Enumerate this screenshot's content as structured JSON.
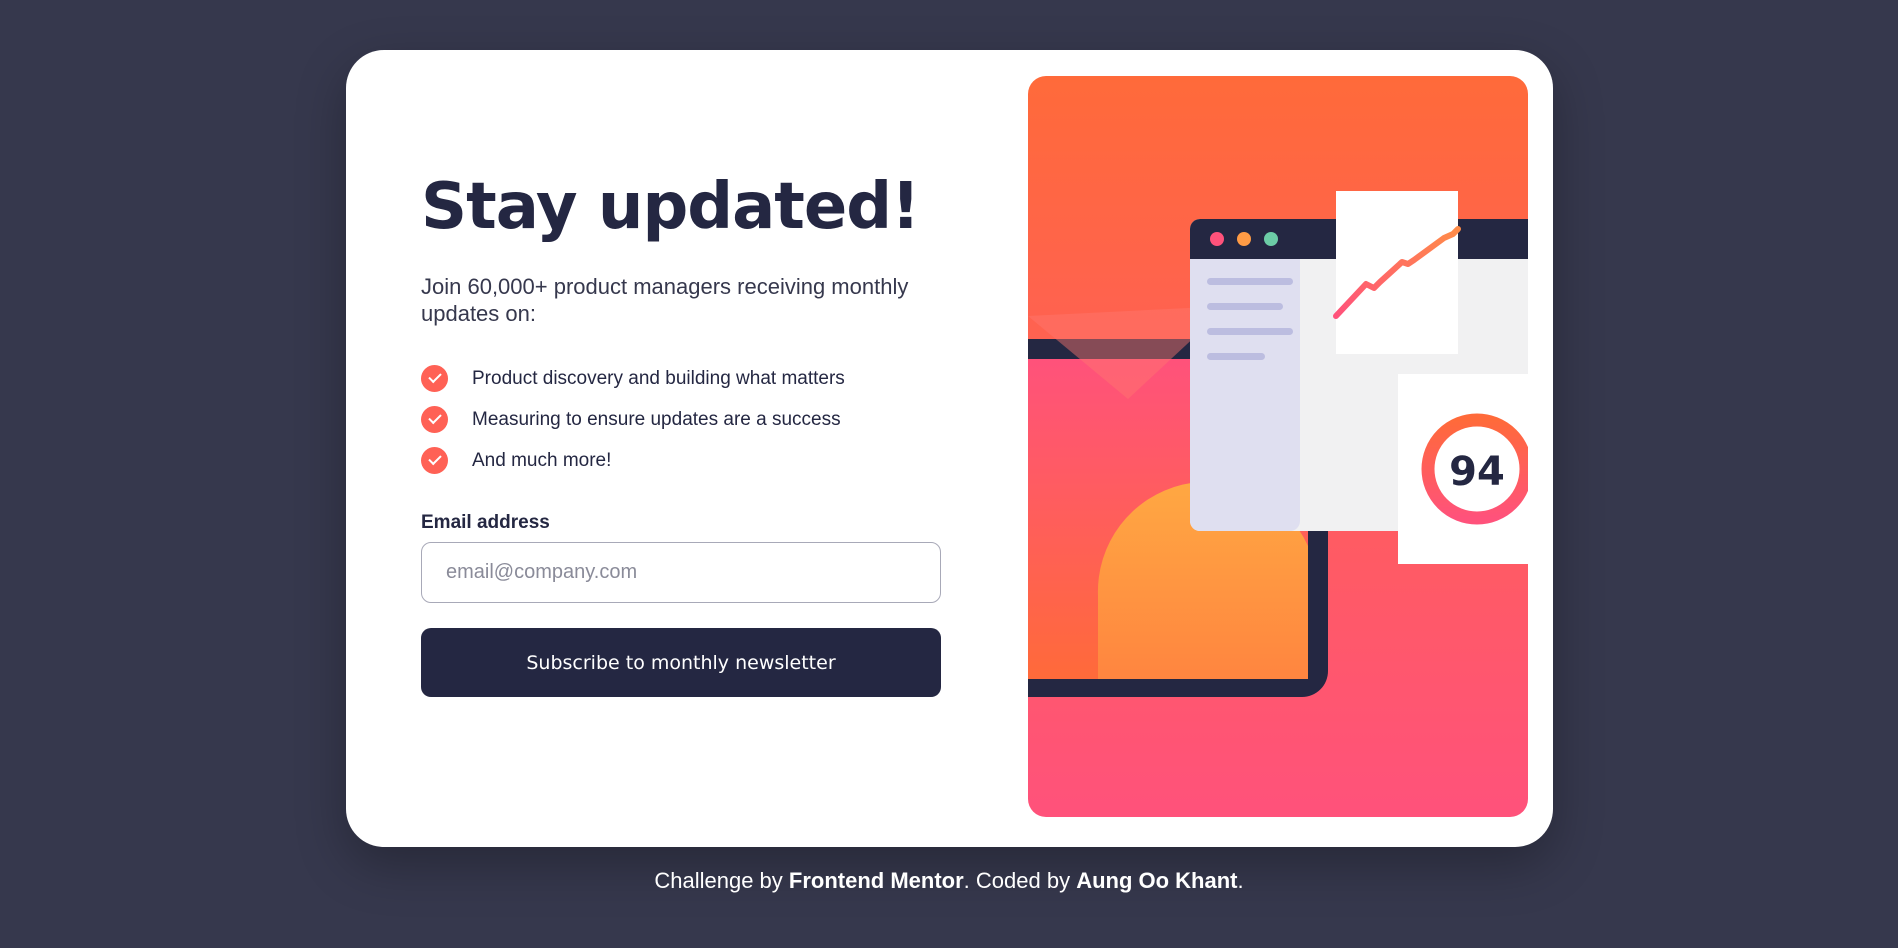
{
  "signup": {
    "title": "Stay updated!",
    "intro": "Join 60,000+ product managers receiving monthly updates on:",
    "features": [
      {
        "text": "Product discovery and building what matters",
        "icon": "check-icon"
      },
      {
        "text": "Measuring to ensure updates are a success",
        "icon": "check-icon"
      },
      {
        "text": "And much more!",
        "icon": "check-icon"
      }
    ],
    "email_label": "Email address",
    "email_placeholder": "email@company.com",
    "email_value": "",
    "button_label": "Subscribe to monthly newsletter"
  },
  "illustration": {
    "score": "94"
  },
  "footer": {
    "prefix": "Challenge by ",
    "link1": "Frontend Mentor",
    "middle": ". Coded by ",
    "link2": "Aung Oo Khant",
    "suffix": "."
  },
  "colors": {
    "page_background": "#36384d",
    "dark_navy": "#242742",
    "tomato": "#ff6155",
    "gradient_pink": "#ff527b",
    "gradient_orange": "#ff6a3a"
  }
}
